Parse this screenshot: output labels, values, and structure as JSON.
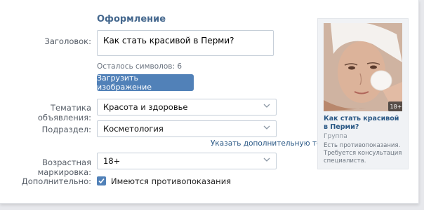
{
  "section": {
    "title": "Оформление"
  },
  "headline": {
    "label": "Заголовок:",
    "value": "Как стать красивой в Перми?",
    "remaining": "Осталось символов: 6"
  },
  "upload_button": "Загрузить изображение",
  "topic": {
    "label": "Тематика объявления:",
    "value": "Красота и здоровье"
  },
  "subsection": {
    "label": "Подраздел:",
    "value": "Косметология"
  },
  "extra_topic_link": "Указать дополнительную тематику",
  "age": {
    "label": "Возрастная маркировка:",
    "value": "18+"
  },
  "additional": {
    "label": "Дополнительно:",
    "checkbox_label": "Имеются противопоказания",
    "checked": true
  },
  "preview": {
    "badge": "18+",
    "title": "Как стать красивой в Перми?",
    "subtitle": "Группа",
    "description": "Есть противопоказания. Требуется консультация специалиста."
  },
  "colors": {
    "accent": "#5181b8",
    "link": "#2a5885",
    "section_title": "#45688e"
  }
}
